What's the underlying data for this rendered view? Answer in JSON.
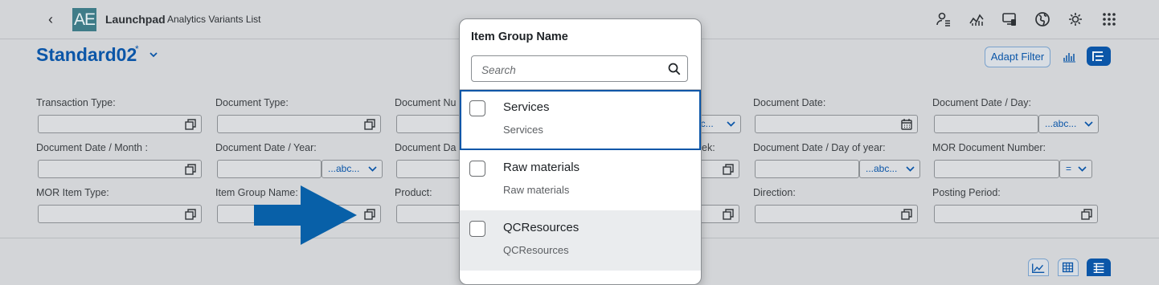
{
  "shell": {
    "logo_text": "AE",
    "title": "Launchpad",
    "subtitle": "Analytics Variants List",
    "icons": [
      "user-settings-icon",
      "analytics-icon",
      "screen-share-icon",
      "globe-icon",
      "theme-icon",
      "app-grid-icon"
    ]
  },
  "variant": {
    "name": "Standard02",
    "modified_marker": "*"
  },
  "toolbar": {
    "adapt_filter": "Adapt Filter"
  },
  "filters": {
    "transaction_type": "Transaction Type:",
    "document_type": "Document Type:",
    "document_number": "Document Nu",
    "document_date": "Document Date:",
    "document_date_day": "Document Date / Day:",
    "document_date_month": "Document Date / Month :",
    "document_date_year": "Document Date / Year:",
    "document_date_partial": "Document Da",
    "week_partial": "ek:",
    "document_date_day_of_year": "Document Date / Day of year:",
    "mor_document_number": "MOR Document Number:",
    "mor_item_type": "MOR Item Type:",
    "item_group_name": "Item Group Name:",
    "product": "Product:",
    "direction": "Direction:",
    "posting_period": "Posting Period:",
    "op_abc": "...abc...",
    "op_abc_partial": "bc...",
    "op_equals": "="
  },
  "popover": {
    "title": "Item Group Name",
    "search_placeholder": "Search",
    "items": [
      {
        "title": "Services",
        "description": "Services",
        "checked": false
      },
      {
        "title": "Raw materials",
        "description": "Raw materials",
        "checked": false
      },
      {
        "title": "QCResources",
        "description": "QCResources",
        "checked": false
      }
    ]
  },
  "colors": {
    "brand": "#0b56a8",
    "arrow": "#0860a8",
    "logo": "#3f7c88"
  }
}
